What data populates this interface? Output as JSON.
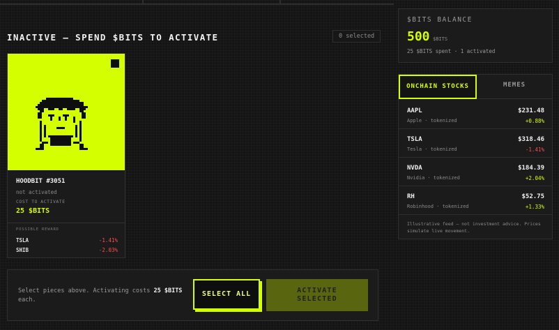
{
  "section": {
    "title": "INACTIVE — SPEND $BITS TO ACTIVATE",
    "selected_count": "0 selected"
  },
  "card": {
    "name": "HOODBIT #3051",
    "status": "not activated",
    "cost_label": "COST TO ACTIVATE",
    "cost": "25 $BITS",
    "reward_label": "POSSIBLE REWARD",
    "rewards": [
      {
        "symbol": "TSLA",
        "change": "-1.41%"
      },
      {
        "symbol": "SHIB",
        "change": "-2.03%"
      }
    ],
    "art_color": "#d4ff00"
  },
  "bottom": {
    "text_prefix": "Select pieces above. Activating costs",
    "text_cost": "25 $BITS",
    "text_suffix": "each.",
    "select_all": "SELECT ALL",
    "activate": "ACTIVATE SELECTED"
  },
  "balance": {
    "label": "$BITS BALANCE",
    "value": "500",
    "unit": "$BITS",
    "sub": "25 $BITS spent · 1 activated"
  },
  "tabs": {
    "onchain": "ONCHAIN STOCKS",
    "memes": "MEMES"
  },
  "stocks": [
    {
      "ticker": "AAPL",
      "desc": "Apple · tokenized",
      "price": "$231.48",
      "change": "+0.88%",
      "direction": "up"
    },
    {
      "ticker": "TSLA",
      "desc": "Tesla · tokenized",
      "price": "$318.46",
      "change": "-1.41%",
      "direction": "down"
    },
    {
      "ticker": "NVDA",
      "desc": "Nvidia · tokenized",
      "price": "$184.39",
      "change": "+2.04%",
      "direction": "up"
    },
    {
      "ticker": "RH",
      "desc": "Robinhood · tokenized",
      "price": "$52.75",
      "change": "+1.33%",
      "direction": "up"
    }
  ],
  "disclaimer": "Illustrative feed — not investment advice. Prices simulate live movement.",
  "colors": {
    "accent": "#d4ff00",
    "negative": "#ff4d4d",
    "background": "#141414",
    "panel": "#1b1b1b"
  }
}
